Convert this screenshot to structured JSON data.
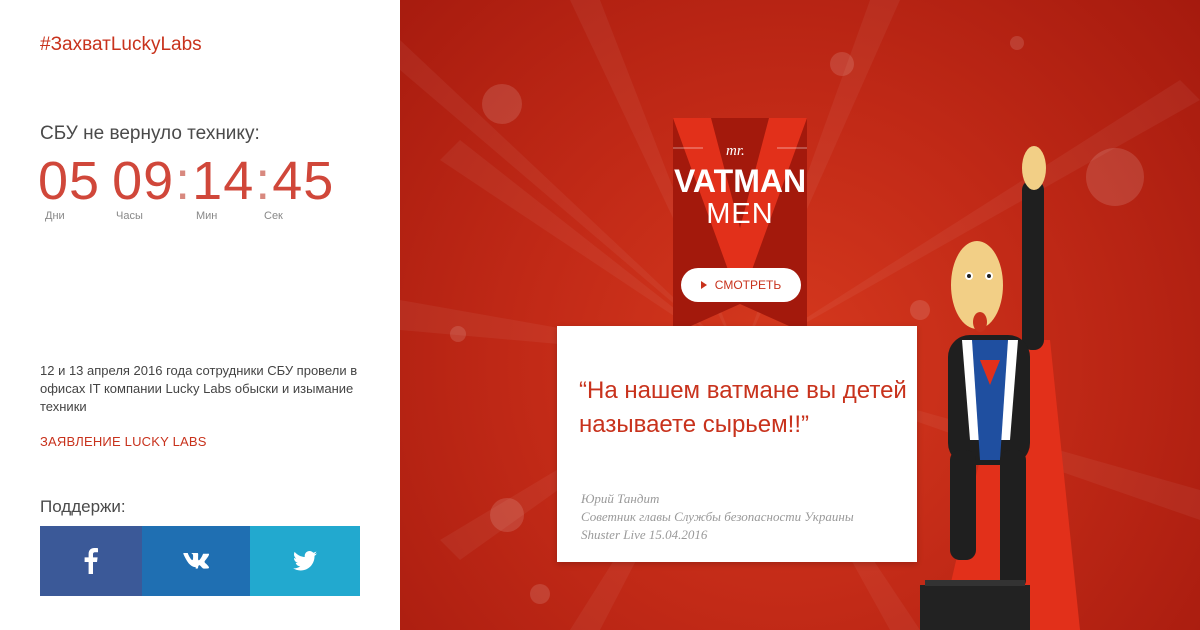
{
  "left": {
    "hashtag": "#ЗахватLuckyLabs",
    "subtitle": "СБУ не вернуло технику:",
    "timer": {
      "days": "05",
      "hours": "09",
      "minutes": "14",
      "seconds": "45"
    },
    "timer_labels": {
      "days": "Дни",
      "hours": "Часы",
      "minutes": "Мин",
      "seconds": "Сек"
    },
    "description": "12 и 13 апреля 2016 года сотрудники СБУ провели в офисах IT компании Lucky Labs обыски и изымание техники",
    "statement_link": "ЗАЯВЛЕНИЕ LUCKY LABS",
    "support_label": "Поддержи:",
    "share": [
      {
        "network": "facebook",
        "icon": "facebook-icon",
        "color": "#3b5998"
      },
      {
        "network": "vk",
        "icon": "vk-icon",
        "color": "#1f6fb2"
      },
      {
        "network": "twitter",
        "icon": "twitter-icon",
        "color": "#22a9cf"
      }
    ]
  },
  "right": {
    "brand": {
      "mr": "mr.",
      "title": "VATMAN",
      "subtitle": "MEN"
    },
    "watch_button": "СМОТРЕТЬ",
    "quote": "“На нашем ватмане вы детей называете сырьем!!”",
    "author": {
      "name": "Юрий Тандит",
      "position": "Советник главы Службы безопасности Украины",
      "source": "Shuster Live 15.04.2016"
    }
  },
  "colors": {
    "accent": "#c8321c",
    "background_red": "#c22a17"
  }
}
